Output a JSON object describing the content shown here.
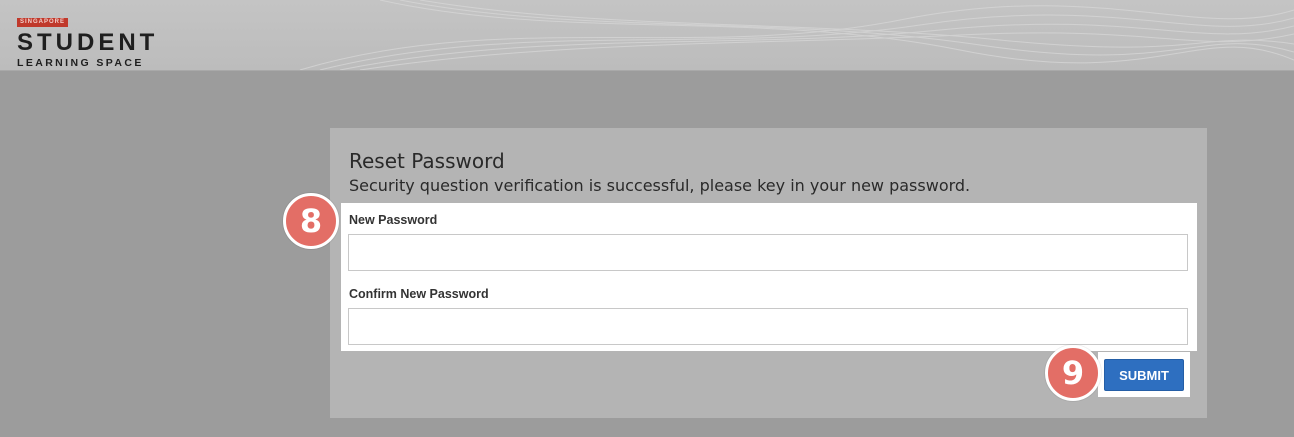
{
  "header": {
    "logo_flag": "SINGAPORE",
    "logo_main": "STUDENT",
    "logo_sub": "LEARNING SPACE"
  },
  "reset": {
    "title": "Reset Password",
    "subtitle": "Security question verification is successful, please key in your new password.",
    "new_password_label": "New Password",
    "new_password_value": "",
    "confirm_password_label": "Confirm New Password",
    "confirm_password_value": "",
    "submit_label": "SUBMIT"
  },
  "steps": {
    "form_step": "8",
    "submit_step": "9"
  },
  "colors": {
    "brand_red": "#c0392b",
    "submit_blue": "#2e6fc0",
    "step_badge": "#e36e66"
  }
}
